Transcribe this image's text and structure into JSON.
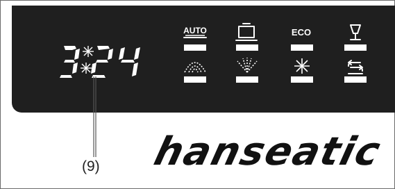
{
  "display": {
    "digits": [
      "3",
      "2",
      "4"
    ]
  },
  "programs": {
    "auto_label": "AUTO",
    "eco_label": "ECO"
  },
  "callout": {
    "label": "(9)"
  },
  "brand": {
    "name": "hanseatic"
  },
  "colors": {
    "panel": "#1f1f1f",
    "symbol": "#ffffff"
  }
}
